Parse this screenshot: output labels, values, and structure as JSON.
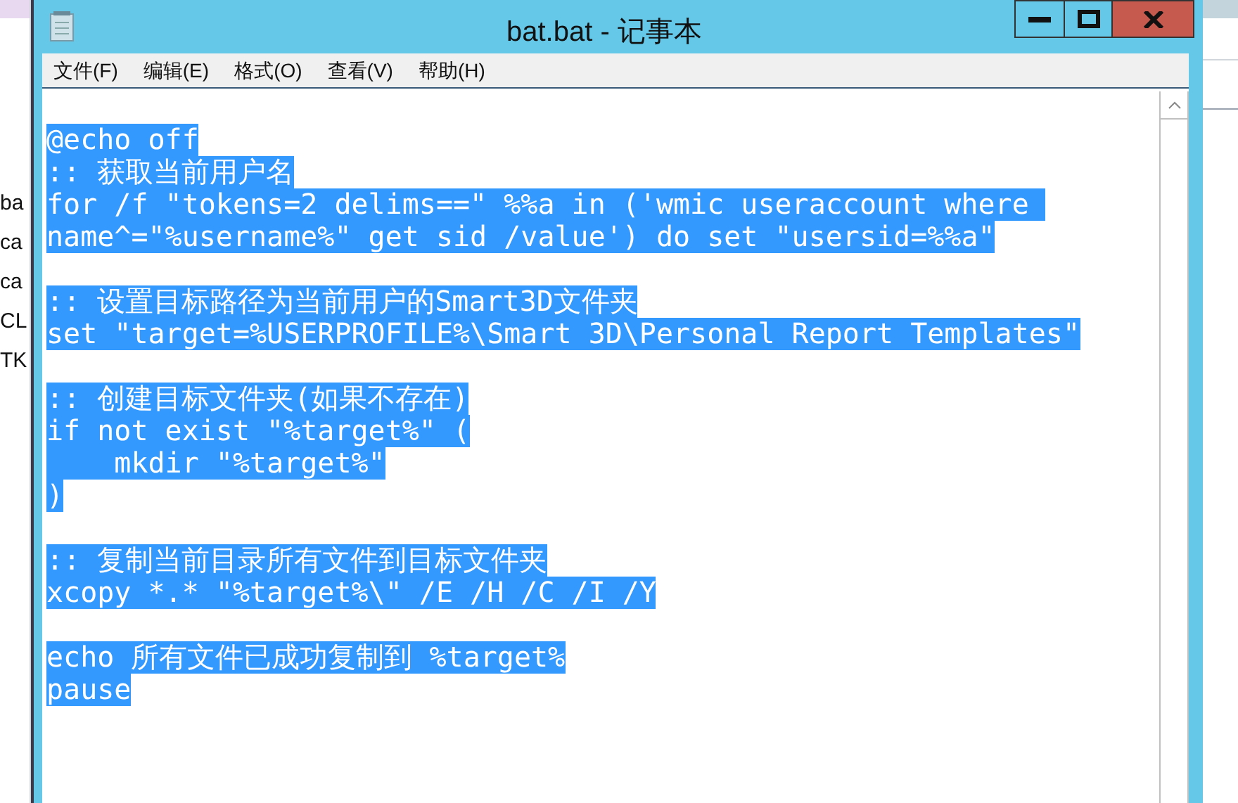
{
  "background_window": {
    "items": [
      "ba",
      "ca",
      "ca",
      "CL",
      "TK"
    ]
  },
  "window": {
    "title": "bat.bat - 记事本"
  },
  "menu": [
    "文件(F)",
    "编辑(E)",
    "格式(O)",
    "查看(V)",
    "帮助(H)"
  ],
  "editor": {
    "lines": [
      {
        "text": "@echo off",
        "selected": true
      },
      {
        "text": ":: 获取当前用户名",
        "selected": true
      },
      {
        "text": "for /f \"tokens=2 delims==\" %%a in ('wmic useraccount where ",
        "selected": true
      },
      {
        "text": "name^=\"%username%\" get sid /value') do set \"usersid=%%a\"",
        "selected": true
      },
      {
        "kind": "blank"
      },
      {
        "text": ":: 设置目标路径为当前用户的Smart3D文件夹",
        "selected": true
      },
      {
        "text": "set \"target=%USERPROFILE%\\Smart 3D\\Personal Report Templates\"",
        "selected": true
      },
      {
        "kind": "blank"
      },
      {
        "text": ":: 创建目标文件夹(如果不存在)",
        "selected": true
      },
      {
        "text": "if not exist \"%target%\" (",
        "selected": true
      },
      {
        "text": "    mkdir \"%target%\"",
        "selected": true
      },
      {
        "text": ")",
        "selected": true
      },
      {
        "kind": "blank"
      },
      {
        "text": ":: 复制当前目录所有文件到目标文件夹",
        "selected": true
      },
      {
        "text": "xcopy *.* \"%target%\\\" /E /H /C /I /Y",
        "selected": true
      },
      {
        "kind": "blank"
      },
      {
        "text": "echo 所有文件已成功复制到 %target%",
        "selected": true
      },
      {
        "text": "pause",
        "selected": true
      }
    ]
  }
}
